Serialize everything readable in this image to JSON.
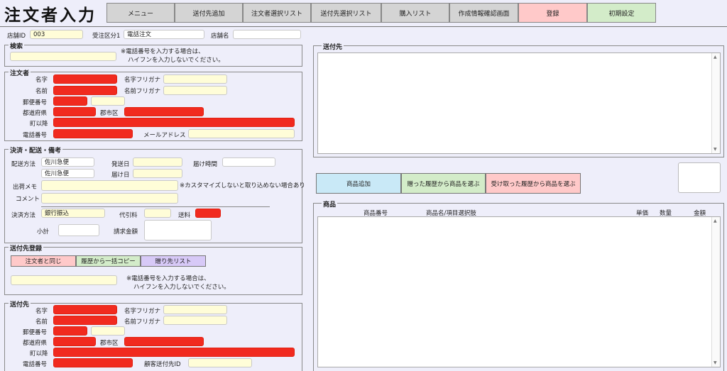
{
  "title": "注文者入力",
  "nav": [
    {
      "label": "メニュー",
      "color": "#d4d4d4"
    },
    {
      "label": "送付先追加",
      "color": "#d4d4d4"
    },
    {
      "label": "注文者選択リスト",
      "color": "#d4d4d4"
    },
    {
      "label": "送付先選択リスト",
      "color": "#d4d4d4"
    },
    {
      "label": "購入リスト",
      "color": "#d4d4d4"
    },
    {
      "label": "作成情報確認画面",
      "color": "#d4d4d4"
    },
    {
      "label": "登録",
      "color": "#ffc9c9"
    },
    {
      "label": "初期設定",
      "color": "#d3ecc9"
    }
  ],
  "store": {
    "id_label": "店舗ID",
    "id_value": "003",
    "kubun_label": "受注区分1",
    "kubun_value": "電話注文",
    "name_label": "店舗名",
    "name_value": ""
  },
  "search": {
    "title": "検索",
    "note1": "※電話番号を入力する場合は、",
    "note2": "ハイフンを入力しないでください。"
  },
  "orderer": {
    "title": "注文者",
    "sei": "名字",
    "sei_kana": "名字フリガナ",
    "mei": "名前",
    "mei_kana": "名前フリガナ",
    "zip": "郵便番号",
    "pref": "都道府県",
    "city": "郡市区",
    "town": "町以降",
    "tel": "電話番号",
    "mail": "メールアドレス"
  },
  "payment": {
    "title": "決済・配送・備考",
    "ship_label": "配送方法",
    "ship1": "佐川急便",
    "ship2": "佐川急便",
    "send_date": "発送日",
    "deliver_time": "届け時間",
    "deliver_date": "届け日",
    "memo_label": "出荷メモ",
    "memo_note": "※カスタマイズしないと取り込めない場合あり",
    "comment_label": "コメント",
    "method_label": "決済方法",
    "method_value": "銀行振込",
    "cod_label": "代引料",
    "fee_label": "送料",
    "subtotal_label": "小計",
    "billing_label": "請求金額"
  },
  "dest_reg": {
    "title": "送付先登録",
    "btn_same": "注文者と同じ",
    "btn_same_color": "#ffc9c9",
    "btn_copy": "履歴から一括コピー",
    "btn_copy_color": "#d3ecc9",
    "btn_list": "贈り先リスト",
    "btn_list_color": "#d7c9f7",
    "note1": "※電話番号を入力する場合は、",
    "note2": "ハイフンを入力しないでください。"
  },
  "dest": {
    "title": "送付先",
    "sei": "名字",
    "sei_kana": "名字フリガナ",
    "mei": "名前",
    "mei_kana": "名前フリガナ",
    "zip": "郵便番号",
    "pref": "都道府県",
    "city": "郡市区",
    "town": "町以降",
    "tel": "電話番号",
    "cust_id": "顧客送付先ID"
  },
  "right": {
    "dest_title": "送付先",
    "btn_add": "商品追加",
    "btn_add_color": "#c9e9f7",
    "btn_sent": "贈った履歴から商品を選ぶ",
    "btn_sent_color": "#d3ecc9",
    "btn_recv": "受け取った履歴から商品を選ぶ",
    "btn_recv_color": "#ffc9c9",
    "products_title": "商品",
    "cols": [
      "商品番号",
      "商品名/項目選択肢",
      "単価",
      "数量",
      "金額"
    ]
  }
}
